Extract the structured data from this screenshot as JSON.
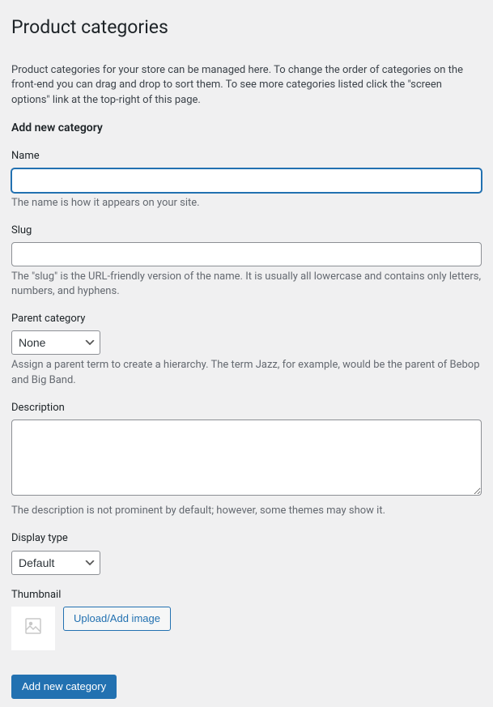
{
  "page": {
    "title": "Product categories",
    "intro": "Product categories for your store can be managed here. To change the order of categories on the front-end you can drag and drop to sort them. To see more categories listed click the \"screen options\" link at the top-right of this page.",
    "subheading": "Add new category"
  },
  "form": {
    "name": {
      "label": "Name",
      "value": "",
      "help": "The name is how it appears on your site."
    },
    "slug": {
      "label": "Slug",
      "value": "",
      "help": "The \"slug\" is the URL-friendly version of the name. It is usually all lowercase and contains only letters, numbers, and hyphens."
    },
    "parent": {
      "label": "Parent category",
      "selected": "None",
      "help": "Assign a parent term to create a hierarchy. The term Jazz, for example, would be the parent of Bebop and Big Band."
    },
    "description": {
      "label": "Description",
      "value": "",
      "help": "The description is not prominent by default; however, some themes may show it."
    },
    "display_type": {
      "label": "Display type",
      "selected": "Default"
    },
    "thumbnail": {
      "label": "Thumbnail",
      "upload_button": "Upload/Add image"
    },
    "submit": "Add new category"
  }
}
